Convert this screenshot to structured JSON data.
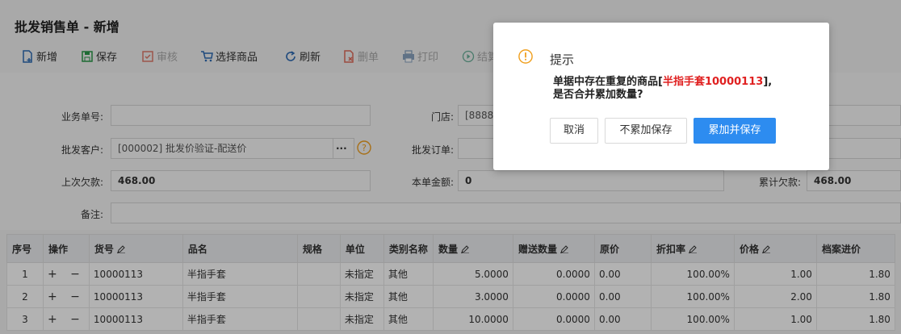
{
  "page": {
    "title": "批发销售单 - 新增"
  },
  "toolbar": {
    "new": "新增",
    "save": "保存",
    "audit": "审核",
    "select_goods": "选择商品",
    "refresh": "刷新",
    "delete": "删单",
    "print": "打印",
    "settle": "结算"
  },
  "form": {
    "order_no_label": "业务单号:",
    "order_no_value": "",
    "store_label": "门店:",
    "store_value": "[8888]",
    "customer_label": "批发客户:",
    "customer_value": "[000002] 批发价验证-配送价",
    "customer_more": "···",
    "wholesale_order_label": "批发订单:",
    "wholesale_order_value": "",
    "last_debt_label": "上次欠款:",
    "last_debt_value": "468.00",
    "amount_label": "本单金额:",
    "amount_value": "0",
    "total_debt_label": "累计欠款:",
    "total_debt_value": "468.00",
    "remark_label": "备注:",
    "remark_value": ""
  },
  "table": {
    "headers": [
      "序号",
      "操作",
      "货号",
      "品名",
      "规格",
      "单位",
      "类别名称",
      "数量",
      "赠送数量",
      "原价",
      "折扣率",
      "价格",
      "档案进价"
    ],
    "rows": [
      {
        "seq": "1",
        "op": "+ −",
        "code": "10000113",
        "name": "半指手套",
        "spec": "",
        "unit": "未指定",
        "category": "其他",
        "qty": "5.0000",
        "gift": "0.0000",
        "orig": "0.00",
        "discount": "100.00%",
        "price": "1.00",
        "cost": "1.80"
      },
      {
        "seq": "2",
        "op": "+ −",
        "code": "10000113",
        "name": "半指手套",
        "spec": "",
        "unit": "未指定",
        "category": "其他",
        "qty": "3.0000",
        "gift": "0.0000",
        "orig": "0.00",
        "discount": "100.00%",
        "price": "2.00",
        "cost": "1.80"
      },
      {
        "seq": "3",
        "op": "+ −",
        "code": "10000113",
        "name": "半指手套",
        "spec": "",
        "unit": "未指定",
        "category": "其他",
        "qty": "10.0000",
        "gift": "0.0000",
        "orig": "0.00",
        "discount": "100.00%",
        "price": "1.00",
        "cost": "1.80"
      }
    ]
  },
  "dialog": {
    "title": "提示",
    "msg_prefix": "单据中存在重复的商品[",
    "msg_highlight": "半指手套10000113",
    "msg_suffix": "],",
    "msg_line2": "是否合并累加数量?",
    "cancel": "取消",
    "no_merge": "不累加保存",
    "merge": "累加并保存"
  },
  "colors": {
    "primary": "#2d8cf0",
    "highlight": "#e02020",
    "warning": "#f0a020"
  }
}
